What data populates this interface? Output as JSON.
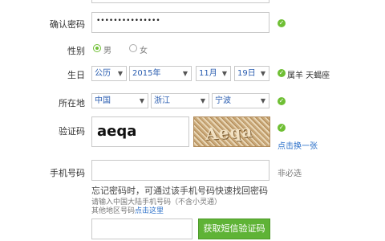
{
  "confirm_password": {
    "label": "确认密码",
    "value": "•••••••••••••••"
  },
  "gender": {
    "label": "性别",
    "male": "男",
    "female": "女"
  },
  "birthday": {
    "label": "生日",
    "calendar": "公历",
    "year": "2015年",
    "month": "11月",
    "day": "19日",
    "info": "属羊 天蝎座"
  },
  "location": {
    "label": "所在地",
    "country": "中国",
    "province": "浙江",
    "city": "宁波"
  },
  "captcha": {
    "label": "验证码",
    "value": "aeqa",
    "image_text": "Aeqa",
    "refresh": "点击换一张"
  },
  "phone": {
    "label": "手机号码",
    "optional": "非必选",
    "hint": "忘记密码时，可通过该手机号码快速找回密码",
    "sub_hint_1": "请输入中国大陆手机号码（不含小灵通）",
    "sub_hint_2_prefix": "其他地区号码",
    "sub_hint_2_link": "点击这里"
  },
  "sms": {
    "button": "获取短信验证码"
  },
  "colors": {
    "accent": "#5fb336",
    "link": "#2a6fc9"
  }
}
